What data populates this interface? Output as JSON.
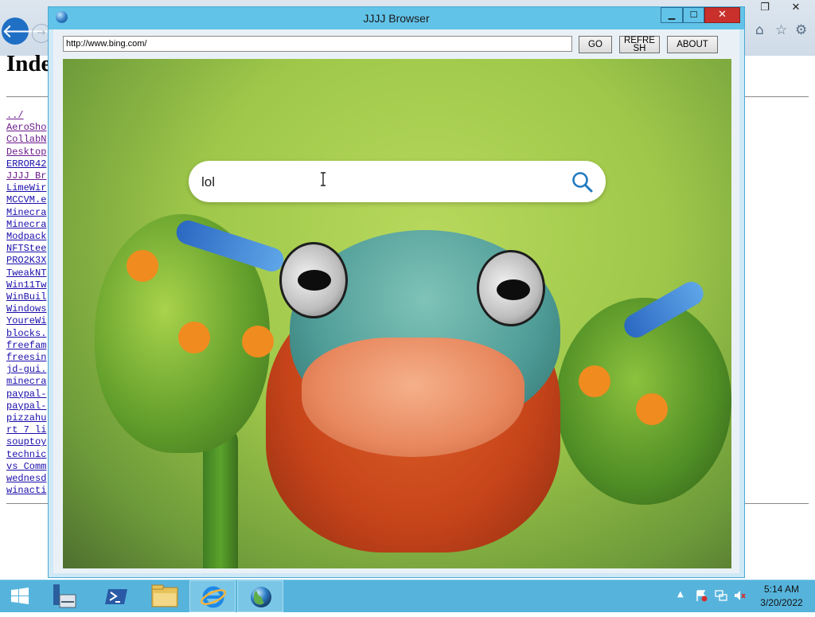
{
  "background_page": {
    "title": "Inde",
    "listing": [
      {
        "name": "../",
        "visited": true
      },
      {
        "name": "AeroSho",
        "visited": true
      },
      {
        "name": "CollabN",
        "visited": true
      },
      {
        "name": "Desktop",
        "visited": true
      },
      {
        "name": "ERROR42",
        "visited": false
      },
      {
        "name": "JJJJ Br",
        "visited": true
      },
      {
        "name": "LimeWir",
        "visited": false
      },
      {
        "name": "MCCVM.e",
        "visited": false
      },
      {
        "name": "Minecra",
        "visited": false
      },
      {
        "name": "Minecra",
        "visited": false
      },
      {
        "name": "Modpack",
        "visited": false
      },
      {
        "name": "NFTStee",
        "visited": false
      },
      {
        "name": "PRO2K3X",
        "visited": false
      },
      {
        "name": "TweakNT",
        "visited": false
      },
      {
        "name": "Win11Tw",
        "visited": false
      },
      {
        "name": "WinBuil",
        "visited": false
      },
      {
        "name": "Windows",
        "visited": false
      },
      {
        "name": "YoureWi",
        "visited": false
      },
      {
        "name": "blocks.",
        "visited": false
      },
      {
        "name": "freefam",
        "visited": false
      },
      {
        "name": "freesin",
        "visited": false
      },
      {
        "name": "jd-gui.",
        "visited": false
      },
      {
        "name": "minecra",
        "visited": false
      },
      {
        "name": "paypal-",
        "visited": false
      },
      {
        "name": "paypal-",
        "visited": false
      },
      {
        "name": "pizzahu",
        "visited": false
      },
      {
        "name": "rt 7 li",
        "visited": false
      },
      {
        "name": "souptoy",
        "visited": false
      },
      {
        "name": "technic",
        "visited": false
      },
      {
        "name": "vs Comm",
        "visited": false
      },
      {
        "name": "wednesd",
        "visited": false
      },
      {
        "name": "winacti",
        "visited": false
      }
    ]
  },
  "ie_window": {
    "back_glyph": "🡐",
    "forward_glyph": "→",
    "restore_glyph": "❐",
    "close_glyph": "✕",
    "home_glyph": "⌂",
    "favorites_glyph": "☆",
    "tools_glyph": "⚙"
  },
  "app": {
    "title": "JJJJ Browser",
    "controls": {
      "minimize": "▁",
      "maximize": "☐",
      "close": "✕"
    },
    "url": "http://www.bing.com/",
    "buttons": {
      "go": "GO",
      "refresh": "REFRESH",
      "about": "ABOUT"
    }
  },
  "web": {
    "search_value": "lol"
  },
  "taskbar": {
    "items": [
      {
        "name": "start",
        "icon": "windows-logo"
      },
      {
        "name": "server-manager",
        "icon": "server-manager-icon"
      },
      {
        "name": "powershell",
        "icon": "powershell-icon"
      },
      {
        "name": "file-explorer",
        "icon": "folder-icon"
      },
      {
        "name": "internet-explorer",
        "icon": "ie-icon",
        "active": true
      },
      {
        "name": "jjjj-browser",
        "icon": "globe-icon",
        "active": true
      }
    ],
    "tray_chevron": "▲",
    "clock_time": "5:14 AM",
    "clock_date": "3/20/2022"
  },
  "colors": {
    "taskbar": "#56b4dc",
    "app_titlebar": "#62c3e8",
    "close_button": "#c9302c",
    "link": "#1a0dab",
    "visited_link": "#6b1a8e"
  }
}
